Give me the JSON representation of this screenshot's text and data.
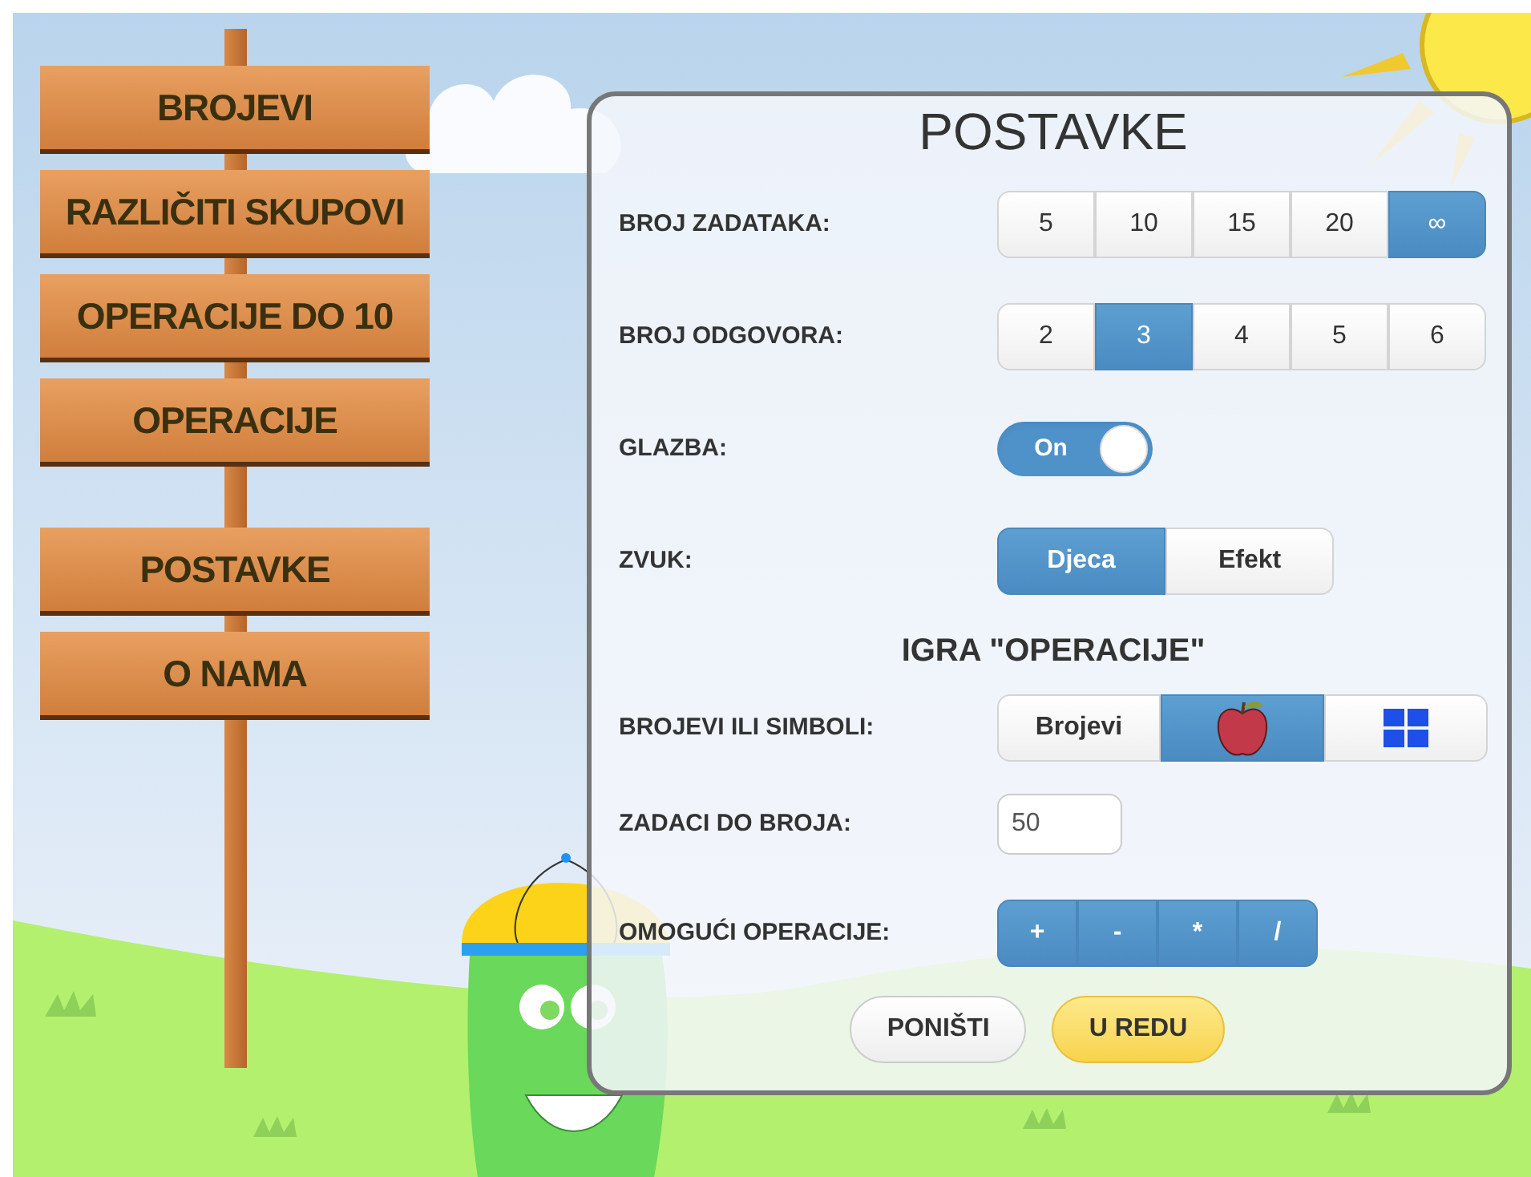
{
  "menu_groups": [
    {
      "items": [
        {
          "label": "BROJEVI"
        },
        {
          "label": "RAZLIČITI SKUPOVI"
        },
        {
          "label": "OPERACIJE DO 10"
        },
        {
          "label": "OPERACIJE"
        }
      ]
    },
    {
      "items": [
        {
          "label": "POSTAVKE"
        },
        {
          "label": "O NAMA"
        }
      ]
    }
  ],
  "settings": {
    "title": "POSTAVKE",
    "rows": [
      {
        "kind": "segmented",
        "label": "BROJ ZADATAKA:",
        "options": [
          {
            "kind": "text",
            "label": "5",
            "selected": false
          },
          {
            "kind": "text",
            "label": "10",
            "selected": false
          },
          {
            "kind": "text",
            "label": "15",
            "selected": false
          },
          {
            "kind": "text",
            "label": "20",
            "selected": false
          },
          {
            "kind": "text",
            "label": "∞",
            "selected": true
          }
        ]
      },
      {
        "kind": "segmented",
        "label": "BROJ ODGOVORA:",
        "options": [
          {
            "kind": "text",
            "label": "2",
            "selected": false
          },
          {
            "kind": "text",
            "label": "3",
            "selected": true
          },
          {
            "kind": "text",
            "label": "4",
            "selected": false
          },
          {
            "kind": "text",
            "label": "5",
            "selected": false
          },
          {
            "kind": "text",
            "label": "6",
            "selected": false
          }
        ]
      },
      {
        "kind": "toggle",
        "label": "GLAZBA:",
        "on": true,
        "text": "On"
      },
      {
        "kind": "segmented",
        "label": "ZVUK:",
        "options": [
          {
            "kind": "text",
            "label": "Djeca",
            "selected": true
          },
          {
            "kind": "text",
            "label": "Efekt",
            "selected": false
          }
        ]
      }
    ],
    "section_title": "IGRA \"OPERACIJE\"",
    "game_rows": [
      {
        "kind": "segmented",
        "label": "BROJEVI ILI SIMBOLI:",
        "options": [
          {
            "kind": "text",
            "label": "Brojevi",
            "selected": false
          },
          {
            "kind": "apple",
            "selected": true
          },
          {
            "kind": "blocks",
            "selected": false
          }
        ]
      },
      {
        "kind": "input",
        "label": "ZADACI DO BROJA:",
        "value": "50"
      },
      {
        "kind": "multi",
        "label": "OMOGUĆI OPERACIJE:",
        "options": [
          {
            "kind": "text",
            "label": "+",
            "selected": true
          },
          {
            "kind": "text",
            "label": "-",
            "selected": true
          },
          {
            "kind": "text",
            "label": "*",
            "selected": true
          },
          {
            "kind": "text",
            "label": "/",
            "selected": true
          }
        ]
      }
    ],
    "buttons": [
      {
        "kind": "secondary",
        "label": "PONIŠTI"
      },
      {
        "kind": "primary",
        "label": "U REDU"
      }
    ]
  }
}
